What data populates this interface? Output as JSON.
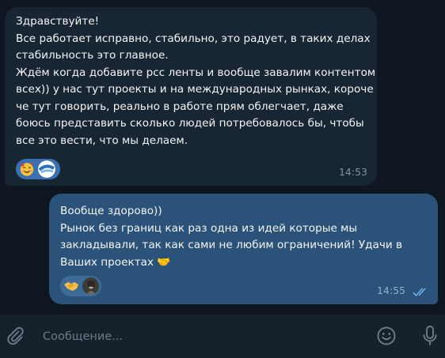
{
  "messages": [
    {
      "direction": "incoming",
      "text": "Здравствуйте!\nВсе работает исправно, стабильно, это радует, в таких делах стабильность это главное.\nЖдём когда добавите рсс ленты и вообще завалим контентом всех)) у нас тут проекты и на международных рынках, короче че тут говорить, реально в работе прям облегчает, даже боюсь представить сколько людей потребовалось бы, чтобы все это вести, что мы делаем.",
      "reactions": [
        "smiling-face-with-hearts-emoji",
        "avatar"
      ],
      "time": "14:53"
    },
    {
      "direction": "outgoing",
      "text": "Вообще здорово))\nРынок без границ как раз одна из идей которые мы закладывали, так как сами не любим ограничений! Удачи в Ваших проектах 🤝",
      "reactions": [
        "handshake-emoji",
        "avatar"
      ],
      "time": "14:55",
      "status": "read"
    }
  ],
  "composer": {
    "placeholder": "Сообщение..."
  },
  "colors": {
    "background": "#0e1621",
    "incoming_bubble": "#182533",
    "outgoing_bubble": "#2b5278",
    "composer": "#17212b",
    "read_checks": "#6ab2f2"
  }
}
